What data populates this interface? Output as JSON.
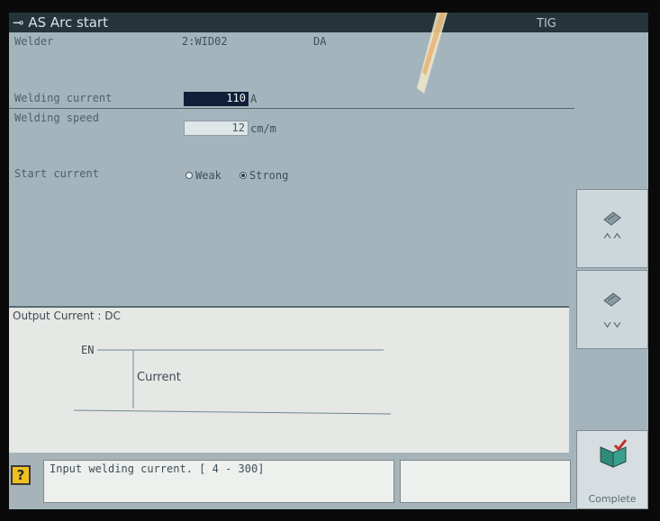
{
  "title_bar": {
    "icon": "arc-start-icon",
    "title": "AS Arc start",
    "mode": "TIG"
  },
  "welder": {
    "label": "Welder",
    "value": "2:WID02",
    "type": "DA"
  },
  "welding_current": {
    "label": "Welding current",
    "value": "110",
    "unit": "A"
  },
  "welding_speed": {
    "label": "Welding speed",
    "value": "12",
    "unit": "cm/m"
  },
  "start_current": {
    "label": "Start current",
    "options": [
      "Weak",
      "Strong"
    ],
    "selected": "Strong"
  },
  "output_panel": {
    "title": "Output Current : DC",
    "en_label": "EN",
    "current_label": "Current"
  },
  "side_buttons": [
    {
      "name": "page-up-button",
      "icon": "scroll-up-icon",
      "arrow": "⌃⌃"
    },
    {
      "name": "page-down-button",
      "icon": "scroll-down-icon",
      "arrow": "⌄⌄"
    }
  ],
  "complete_button": {
    "label": "Complete",
    "icon": "book-check-icon"
  },
  "status": {
    "help_icon": "?",
    "message": "Input welding current. [ 4 - 300]",
    "secondary": ""
  },
  "colors": {
    "screen_bg": "#a4b4bd",
    "title_bar": "#24343a",
    "active_field": "#102038",
    "panel_bg": "#e6e8e6"
  }
}
